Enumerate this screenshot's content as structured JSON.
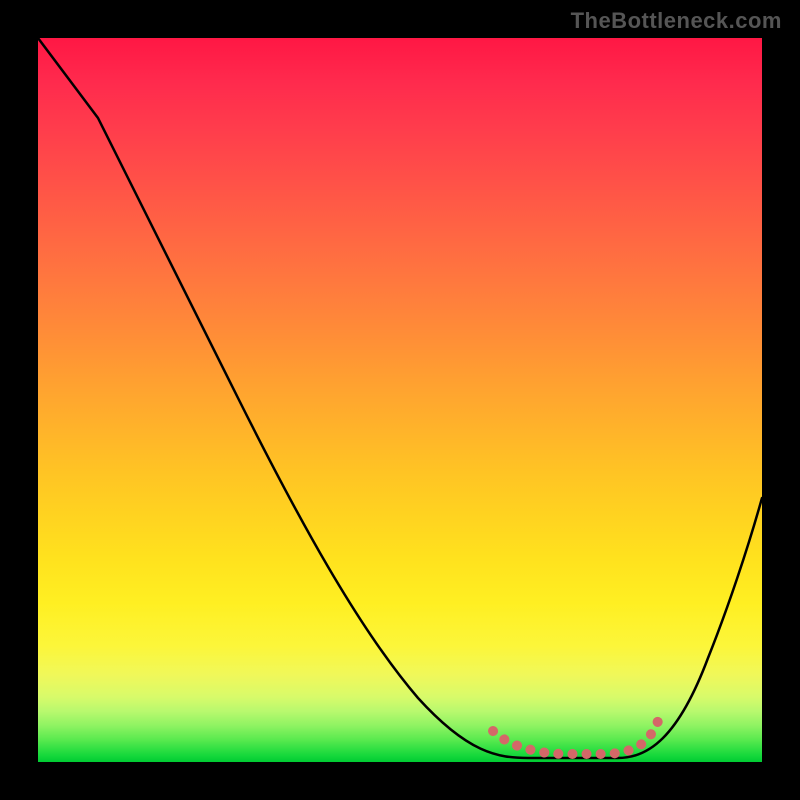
{
  "watermark": "TheBottleneck.com",
  "chart_data": {
    "type": "line",
    "title": "",
    "xlabel": "",
    "ylabel": "",
    "xlim": [
      0,
      100
    ],
    "ylim": [
      0,
      100
    ],
    "grid": false,
    "legend": false,
    "background": "vertical_gradient_red_to_green",
    "series": [
      {
        "name": "main-curve",
        "color": "#000000",
        "x": [
          0,
          8,
          14,
          21,
          28,
          36,
          44,
          52,
          59,
          64,
          68,
          72,
          78,
          82,
          86,
          90,
          93,
          96,
          100
        ],
        "values": [
          100,
          89,
          78,
          67,
          56,
          44,
          32,
          20,
          10,
          4,
          1,
          1,
          1,
          1,
          3,
          9,
          17,
          27,
          37
        ]
      },
      {
        "name": "bottom-accent-dots",
        "color": "#d46868",
        "x": [
          63,
          65,
          67.5,
          70,
          73,
          76,
          79,
          82,
          84,
          85.5
        ],
        "values": [
          4.3,
          3.1,
          2.2,
          1.5,
          1.2,
          1.2,
          1.2,
          1.5,
          2.4,
          5.6
        ]
      }
    ],
    "notes": "No axis ticks or numeric labels are rendered; y-values are normalized 0–100 where 100 is the top of the gradient area and 0 is the bottom. x-values are normalized 0–100 left-to-right."
  }
}
